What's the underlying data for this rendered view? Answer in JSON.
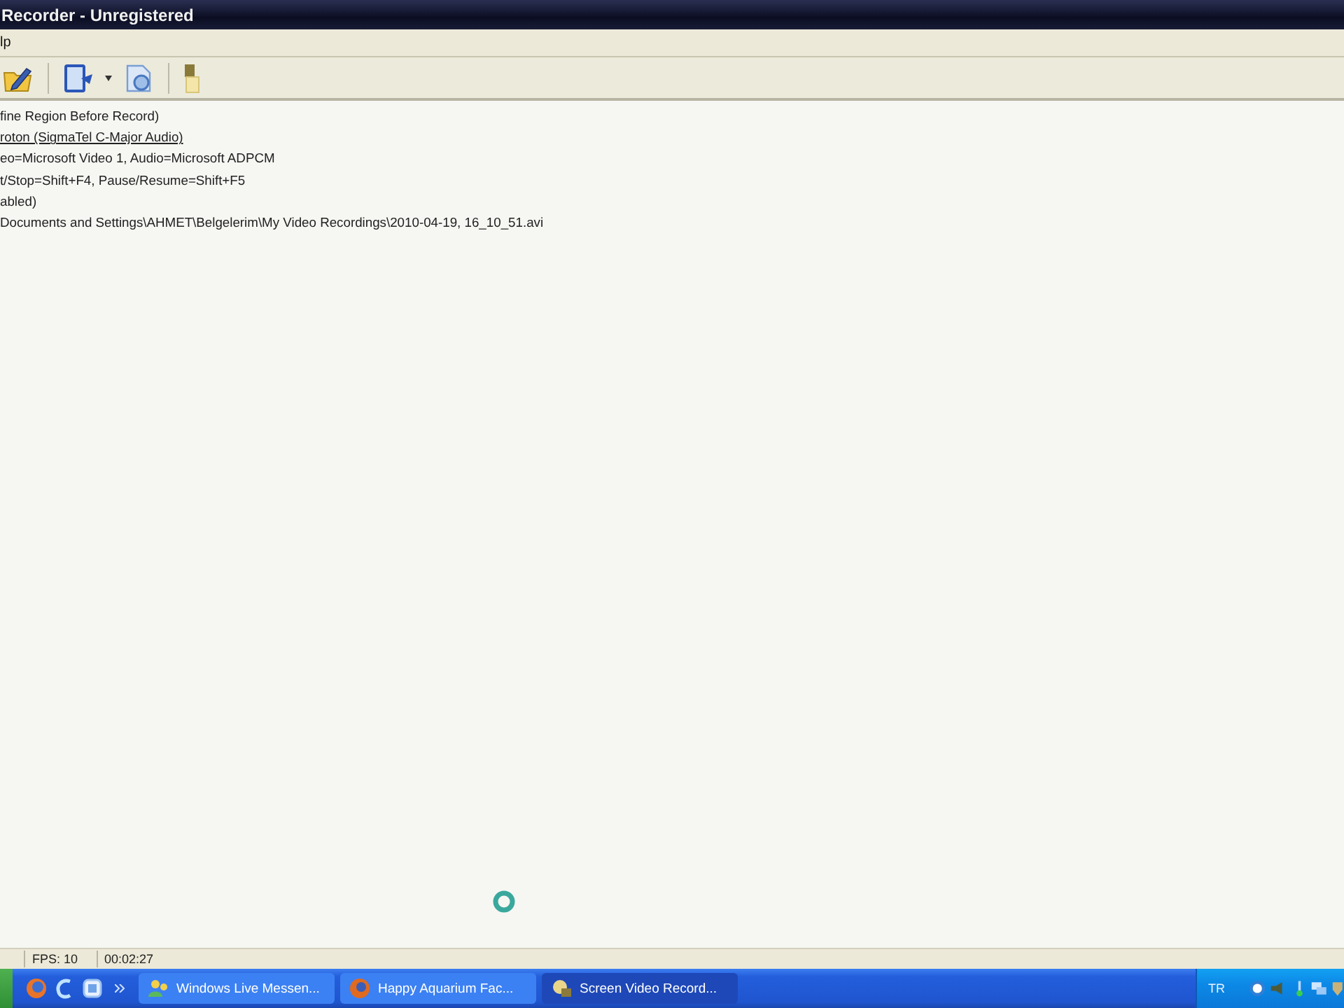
{
  "window": {
    "title": "Recorder - Unregistered"
  },
  "menu": [
    {
      "label": "lp"
    }
  ],
  "info_lines": [
    {
      "text": "fine Region Before Record)",
      "link": false
    },
    {
      "text": "roton (SigmaTel C-Major Audio)",
      "link": true
    },
    {
      "text": "eo=Microsoft Video 1, Audio=Microsoft ADPCM",
      "link": false
    },
    {
      "text": "t/Stop=Shift+F4, Pause/Resume=Shift+F5",
      "link": false
    },
    {
      "text": "abled)",
      "link": false
    },
    {
      "text": "Documents and Settings\\AHMET\\Belgelerim\\My Video Recordings\\2010-04-19, 16_10_51.avi",
      "link": false
    }
  ],
  "status_bar": [
    "FPS: 10",
    "00:02:27"
  ],
  "taskbar": {
    "tasks": [
      {
        "label": "Windows Live Messen...",
        "selected": false
      },
      {
        "label": "Happy Aquarium Fac...",
        "selected": false
      },
      {
        "label": "Screen Video Record...",
        "selected": true
      }
    ],
    "tray": {
      "language": "TR"
    }
  }
}
